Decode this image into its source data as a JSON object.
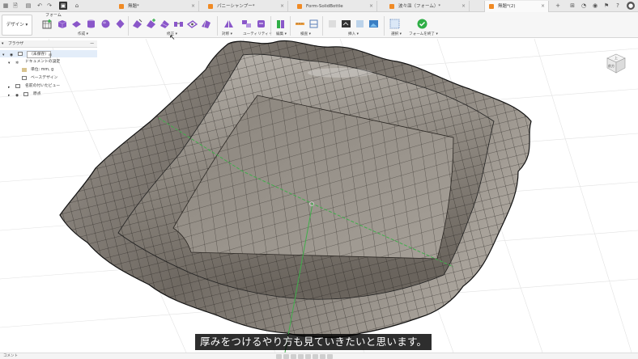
{
  "tabs": [
    {
      "label": "無題*",
      "active": false
    },
    {
      "label": "パニーシャンプー*",
      "active": false
    },
    {
      "label": "Form-SolidBottle",
      "active": false
    },
    {
      "label": "波々皿（フォーム）*",
      "active": false
    },
    {
      "label": "無題*(2)",
      "active": true
    }
  ],
  "toolbar": {
    "workspace": "デザイン ▾",
    "form_tab": "フォーム",
    "groups": [
      "作成 ▾",
      "修正 ▾",
      "対称 ▾",
      "ユーティリティ ▾",
      "編集 ▾",
      "検査 ▾",
      "挿入 ▾",
      "選択 ▾",
      "フォームを終了 ▾"
    ]
  },
  "browser": {
    "title": "ブラウザ",
    "items": [
      "（未保存）",
      "ドキュメントの設定",
      "単位: mm, g",
      "ベースデザイン",
      "名前の付いたビュー",
      "原点"
    ]
  },
  "viewcube": {
    "top": "上",
    "front": "前方"
  },
  "subtitle": "厚みをつけるやり方も見ていきたいと思います。",
  "bottom": {
    "comments": "コメント"
  },
  "colors": {
    "accent": "#f08a24",
    "tool_purple": "#8a57c9",
    "finish_green": "#2fae46",
    "surface": "#7e7870"
  }
}
